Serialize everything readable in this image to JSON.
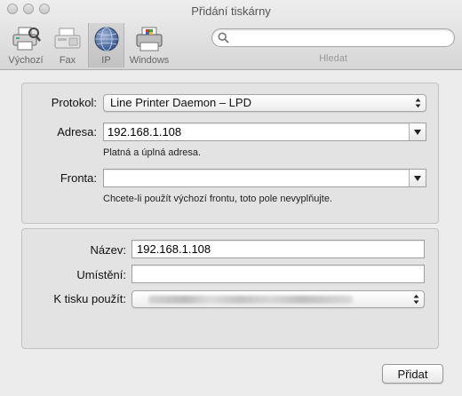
{
  "window": {
    "title": "Přidání tiskárny"
  },
  "toolbar": {
    "items": [
      {
        "label": "Výchozí",
        "icon": "default-printer-icon"
      },
      {
        "label": "Fax",
        "icon": "fax-icon"
      },
      {
        "label": "IP",
        "icon": "network-globe-icon",
        "selected": true
      },
      {
        "label": "Windows",
        "icon": "windows-printer-icon"
      }
    ],
    "search": {
      "value": "",
      "label": "Hledat"
    }
  },
  "connection": {
    "protocol_label": "Protokol:",
    "protocol_value": "Line Printer Daemon – LPD",
    "address_label": "Adresa:",
    "address_value": "192.168.1.108",
    "address_hint": "Platná a úplná adresa.",
    "queue_label": "Fronta:",
    "queue_value": "",
    "queue_hint": "Chcete-li použít výchozí frontu, toto pole nevyplňujte."
  },
  "details": {
    "name_label": "Název:",
    "name_value": "192.168.1.108",
    "location_label": "Umístění:",
    "location_value": "",
    "use_label": "K tisku použít:"
  },
  "buttons": {
    "add_label": "Přidat"
  }
}
